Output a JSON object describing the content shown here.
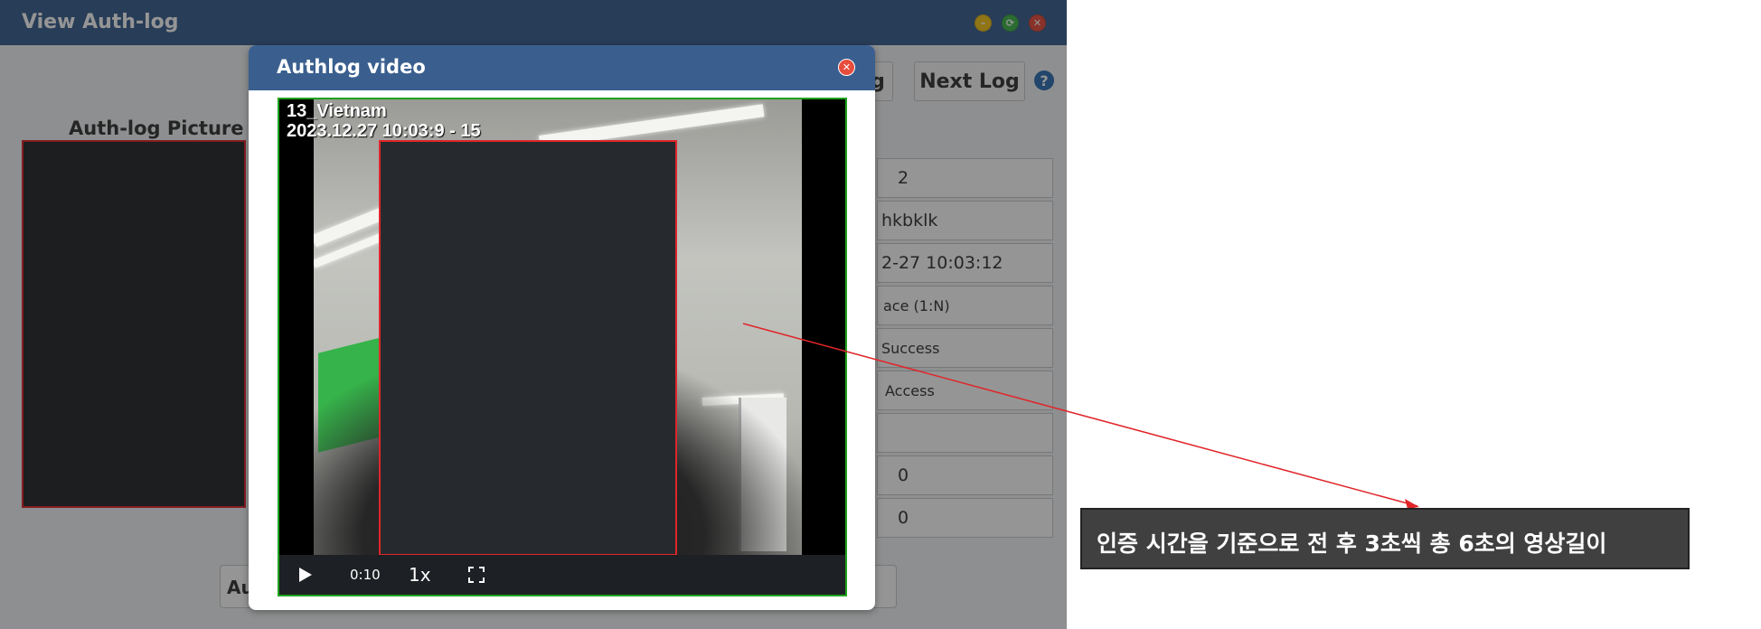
{
  "window": {
    "title": "View Auth-log",
    "controls": [
      "minimize",
      "maximize",
      "close"
    ]
  },
  "toolbar": {
    "prev_log_partial": "g",
    "next_log_label": "Next Log",
    "help_icon": "question-circle-icon"
  },
  "picture": {
    "heading": "Auth-log Picture"
  },
  "fields": [
    "2",
    "hkbklk",
    "2-27 10:03:12",
    "ace (1:N)",
    "Success",
    "Access",
    "",
    "0",
    "0"
  ],
  "bottom_buttons": {
    "left_partial": "Au"
  },
  "modal": {
    "title": "Authlog video",
    "caption_line1": "13_Vietnam",
    "caption_line2": "2023.12.27 10:03:9 - 15",
    "time": "0:10",
    "speed": "1x"
  },
  "annotation": {
    "text": "인증 시간을 기준으로 전 후 3초씩 총 6초의 영상길이",
    "color": "#e0262a"
  },
  "colors": {
    "titlebar": "#3a5f8f",
    "video_border": "#1ea31e",
    "redaction_border": "#e0262a"
  }
}
